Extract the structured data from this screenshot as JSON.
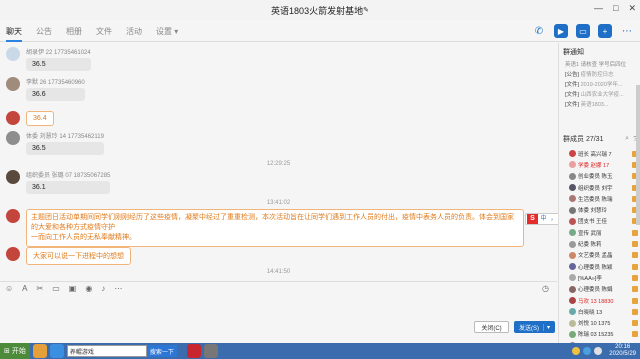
{
  "window": {
    "title": "英语1803火箭发射基地",
    "edit_icon": "pencil-icon",
    "controls": [
      "—",
      "□",
      "✕"
    ]
  },
  "tabs": [
    {
      "label": "聊天",
      "active": true
    },
    {
      "label": "公告"
    },
    {
      "label": "相册"
    },
    {
      "label": "文件"
    },
    {
      "label": "活动"
    },
    {
      "label": "设置 ▾"
    }
  ],
  "toolbar_icons": [
    "phone-icon",
    "video-icon",
    "screen-share-icon",
    "add-icon",
    "more-icon"
  ],
  "messages": [
    {
      "sender": "胡录伊 22 17735461024",
      "text": "36.5",
      "style": "normal"
    },
    {
      "sender": "李默 26 17735460960",
      "text": "36.6",
      "style": "normal"
    },
    {
      "sender": "",
      "text": "36.4",
      "style": "orange"
    },
    {
      "sender": "体委 刘慧玲 14 17735462119",
      "text": "36.5",
      "style": "normal"
    },
    {
      "sender": "组织委员 张璐 07 18735067285",
      "text": "36.1",
      "style": "normal"
    },
    {
      "sender": "",
      "text": "主题团日活动单期间同学们刚刚经历了这些疫情，凝聚中经过了重重检测，本次活动旨在让同学们遇到工作人员的付出，疫情中表务人员的负责。体会到国家的大爱和各种方式疫情守护",
      "style": "orange-long",
      "text2": "一而向工作人员的无私奉献精神。"
    },
    {
      "sender": "",
      "text": "大家可以说一下进程中的想想",
      "style": "orange"
    }
  ],
  "timestamps": [
    "12:29:25",
    "13:41:02",
    "14:41:50"
  ],
  "input_tools": [
    "emoji-icon",
    "font-icon",
    "scissors-icon",
    "folder-icon",
    "image-icon",
    "gift-icon",
    "voice-icon",
    "history-icon"
  ],
  "buttons": {
    "close": "关闭(C)",
    "send": "发送(S)",
    "send_arrow": "▾"
  },
  "sidebar": {
    "notice_title": "群通知",
    "notice_sub": "英语1 请核查 学号后四位",
    "notices": [
      {
        "tag": "[公告]",
        "text": "疫情防控日志"
      },
      {
        "tag": "[文件]",
        "text": "2019-2020学年..."
      },
      {
        "tag": "[文件]",
        "text": "山西农业大学疫..."
      },
      {
        "tag": "[文件]",
        "text": "英语1803..."
      }
    ],
    "members_label": "群成员",
    "members_count": "27/31",
    "members": [
      {
        "name": "班长 高兴瑞 7",
        "red": false
      },
      {
        "name": "学委 赵娜 17",
        "red": true
      },
      {
        "name": "创业委员 陈玉",
        "red": false
      },
      {
        "name": "组织委员 刘宇",
        "red": false
      },
      {
        "name": "生活委员 陈瑞",
        "red": false
      },
      {
        "name": "体委 刘慧玲",
        "red": false
      },
      {
        "name": "团支书 王佳",
        "red": false
      },
      {
        "name": "宣传 武丽",
        "red": false
      },
      {
        "name": "纪委 陈莉",
        "red": false
      },
      {
        "name": "文艺委员 孟晶",
        "red": false
      },
      {
        "name": "心理委员 陈颖",
        "red": false
      },
      {
        "name": "[%AA»]李",
        "red": false
      },
      {
        "name": "心理委员 陈娟",
        "red": false
      },
      {
        "name": "马欢 13 18830",
        "red": true
      },
      {
        "name": "白晓晓 13",
        "red": false
      },
      {
        "name": "刘悦 10 1375",
        "red": false
      },
      {
        "name": "陈瑞 03 15235",
        "red": false
      },
      {
        "name": "马丽 19 1375",
        "red": false
      },
      {
        "name": "刘 24 1375",
        "red": false
      }
    ]
  },
  "taskbar": {
    "start": "开始",
    "search_text": "养鲲游戏",
    "search_button": "搜索一下",
    "time": "20:16",
    "date": "2020/5/29"
  }
}
